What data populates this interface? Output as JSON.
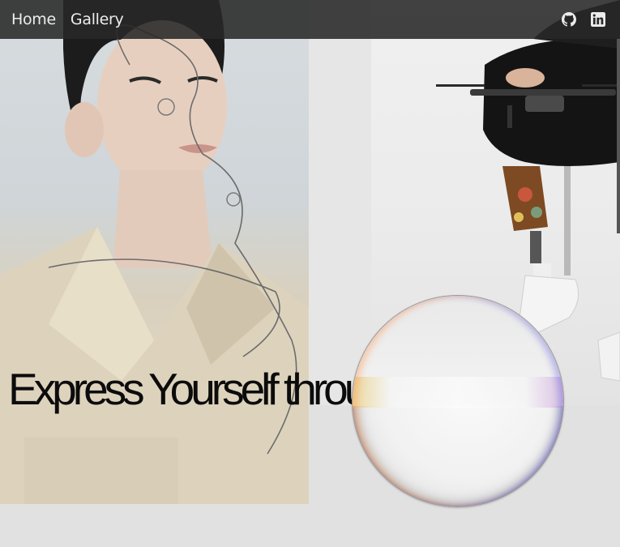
{
  "nav": {
    "links": [
      {
        "label": "Home"
      },
      {
        "label": "Gallery"
      }
    ],
    "icons": [
      {
        "name": "github-icon"
      },
      {
        "name": "linkedin-icon"
      }
    ]
  },
  "hero": {
    "title": "Express Yourself through Fashion"
  },
  "colors": {
    "navbar": "#282828",
    "page_background": "#e1e1e1",
    "title": "#0c0c0c"
  }
}
